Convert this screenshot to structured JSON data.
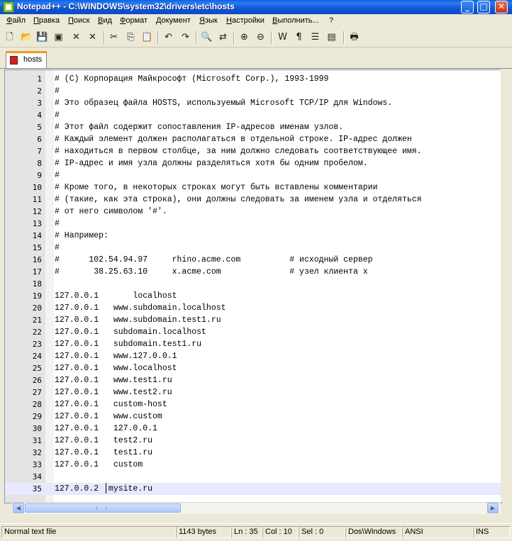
{
  "window": {
    "title": "Notepad++ - C:\\WINDOWS\\system32\\drivers\\etc\\hosts",
    "minimize_glyph": "_",
    "maximize_glyph": "□",
    "close_glyph": "✕"
  },
  "menu": [
    "Файл",
    "Правка",
    "Поиск",
    "Вид",
    "Формат",
    "Документ",
    "Язык",
    "Настройки",
    "Выполнить...",
    "?"
  ],
  "toolbar": [
    {
      "name": "new-file-icon",
      "glyph": "🗋"
    },
    {
      "name": "open-file-icon",
      "glyph": "📂"
    },
    {
      "name": "save-icon",
      "glyph": "💾"
    },
    {
      "name": "save-all-icon",
      "glyph": "▣"
    },
    {
      "name": "close-icon",
      "glyph": "✕"
    },
    {
      "name": "close-all-icon",
      "glyph": "✕"
    },
    {
      "name": "cut-icon",
      "glyph": "✂"
    },
    {
      "name": "copy-icon",
      "glyph": "⎘"
    },
    {
      "name": "paste-icon",
      "glyph": "📋"
    },
    {
      "name": "undo-icon",
      "glyph": "↶"
    },
    {
      "name": "redo-icon",
      "glyph": "↷"
    },
    {
      "name": "find-icon",
      "glyph": "🔍"
    },
    {
      "name": "replace-icon",
      "glyph": "⇄"
    },
    {
      "name": "zoom-in-icon",
      "glyph": "⊕"
    },
    {
      "name": "zoom-out-icon",
      "glyph": "⊖"
    },
    {
      "name": "word-wrap-icon",
      "glyph": "W"
    },
    {
      "name": "show-all-chars-icon",
      "glyph": "¶"
    },
    {
      "name": "indent-guide-icon",
      "glyph": "☰"
    },
    {
      "name": "user-language-icon",
      "glyph": "▤"
    },
    {
      "name": "print-icon",
      "glyph": "🖶"
    }
  ],
  "tab": {
    "label": "hosts"
  },
  "editor": {
    "current_line": 35,
    "lines": [
      "# (C) Корпорация Майкрософт (Microsoft Corp.), 1993-1999",
      "#",
      "# Это образец файла HOSTS, используемый Microsoft TCP/IP для Windows.",
      "#",
      "# Этот файл содержит сопоставления IP-адресов именам узлов.",
      "# Каждый элемент должен располагаться в отдельной строке. IP-адрес должен",
      "# находиться в первом столбце, за ним должно следовать соответствующее имя.",
      "# IP-адрес и имя узла должны разделяться хотя бы одним пробелом.",
      "#",
      "# Кроме того, в некоторых строках могут быть вставлены комментарии",
      "# (такие, как эта строка), они должны следовать за именем узла и отделяться",
      "# от него символом '#'.",
      "#",
      "# Например:",
      "#",
      "#      102.54.94.97     rhino.acme.com          # исходный сервер",
      "#       38.25.63.10     x.acme.com              # узел клиента x",
      "",
      "127.0.0.1       localhost",
      "127.0.0.1   www.subdomain.localhost",
      "127.0.0.1   www.subdomain.test1.ru",
      "127.0.0.1   subdomain.localhost",
      "127.0.0.1   subdomain.test1.ru",
      "127.0.0.1   www.127.0.0.1",
      "127.0.0.1   www.localhost",
      "127.0.0.1   www.test1.ru",
      "127.0.0.1   www.test2.ru",
      "127.0.0.1   custom-host",
      "127.0.0.1   www.custom",
      "127.0.0.1   127.0.0.1",
      "127.0.0.1   test2.ru",
      "127.0.0.1   test1.ru",
      "127.0.0.1   custom",
      "",
      "127.0.0.2  mysite.ru"
    ]
  },
  "status": {
    "type": "Normal text file",
    "length": "1143 bytes",
    "ln": "Ln : 35",
    "col": "Col : 10",
    "sel": "Sel : 0",
    "eol": "Dos\\Windows",
    "encoding": "ANSI",
    "mode": "INS"
  }
}
